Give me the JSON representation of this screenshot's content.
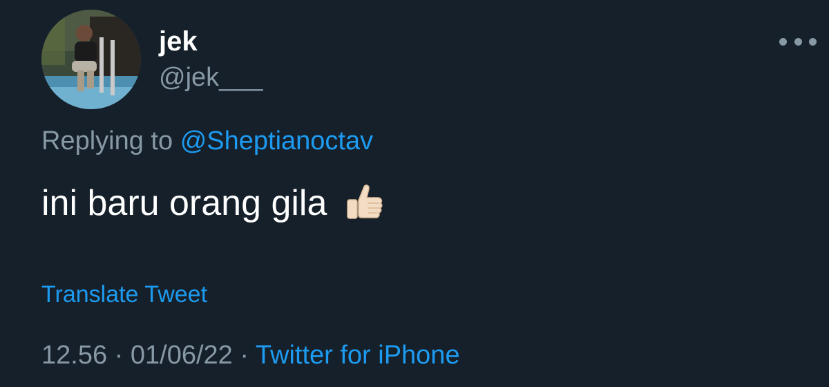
{
  "author": {
    "display_name": "jek",
    "handle": "@jek___"
  },
  "reply": {
    "prefix": "Replying to",
    "mention": "@Sheptianoctav"
  },
  "tweet": {
    "text": "ini baru orang gila",
    "emoji": "thumbs-up-icon"
  },
  "translate_label": "Translate Tweet",
  "meta": {
    "time": "12.56",
    "separator": "·",
    "date": "01/06/22",
    "source": "Twitter for iPhone"
  },
  "colors": {
    "background": "#15202b",
    "text": "#ffffff",
    "secondary": "#8899a6",
    "accent": "#1d9bf0"
  }
}
